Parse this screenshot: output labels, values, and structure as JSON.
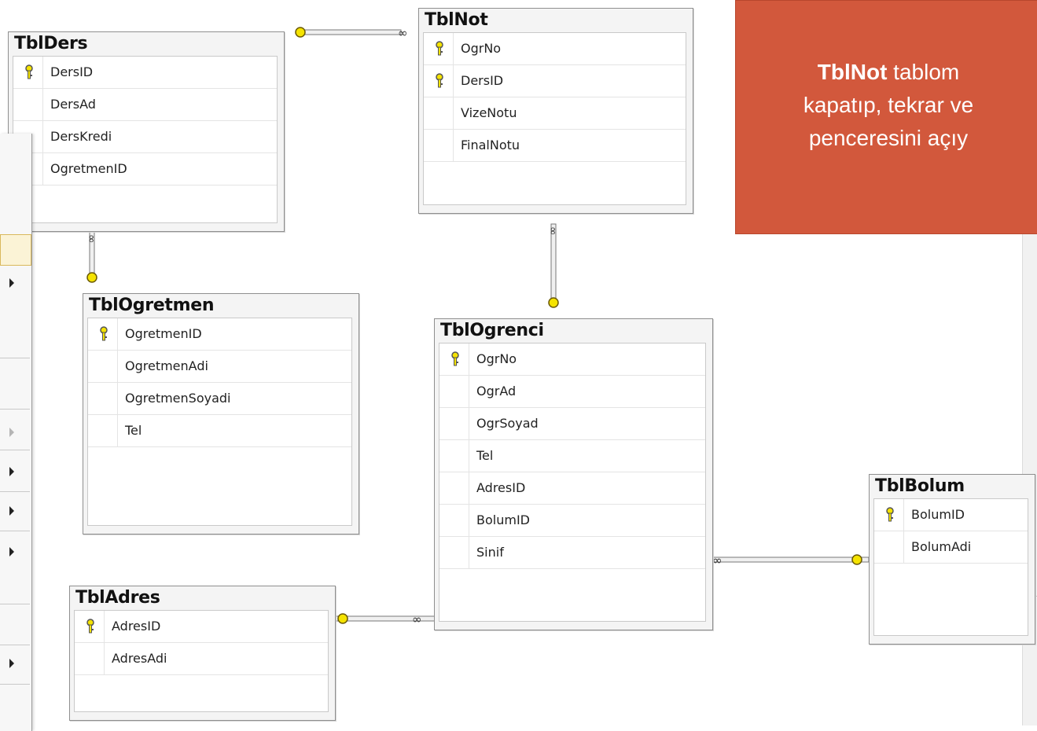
{
  "callout": {
    "bold": "TblNot",
    "line1_rest": " tablom",
    "line2": "kapatıp, tekrar ve",
    "line3": "penceresini açıy"
  },
  "tables": {
    "ders": {
      "title": "TblDers",
      "cols": [
        "DersID",
        "DersAd",
        "DersKredi",
        "OgretmenID"
      ]
    },
    "not": {
      "title": "TblNot",
      "cols": [
        "OgrNo",
        "DersID",
        "VizeNotu",
        "FinalNotu"
      ]
    },
    "ogretmen": {
      "title": "TblOgretmen",
      "cols": [
        "OgretmenID",
        "OgretmenAdi",
        "OgretmenSoyadi",
        "Tel"
      ]
    },
    "ogrenci": {
      "title": "TblOgrenci",
      "cols": [
        "OgrNo",
        "OgrAd",
        "OgrSoyad",
        "Tel",
        "AdresID",
        "BolumID",
        "Sinif"
      ]
    },
    "bolum": {
      "title": "TblBolum",
      "cols": [
        "BolumID",
        "BolumAdi"
      ]
    },
    "adres": {
      "title": "TblAdres",
      "cols": [
        "AdresID",
        "AdresAdi"
      ]
    }
  },
  "colors": {
    "callout_bg": "#d2583c",
    "key_yellow": "#f5e300"
  }
}
